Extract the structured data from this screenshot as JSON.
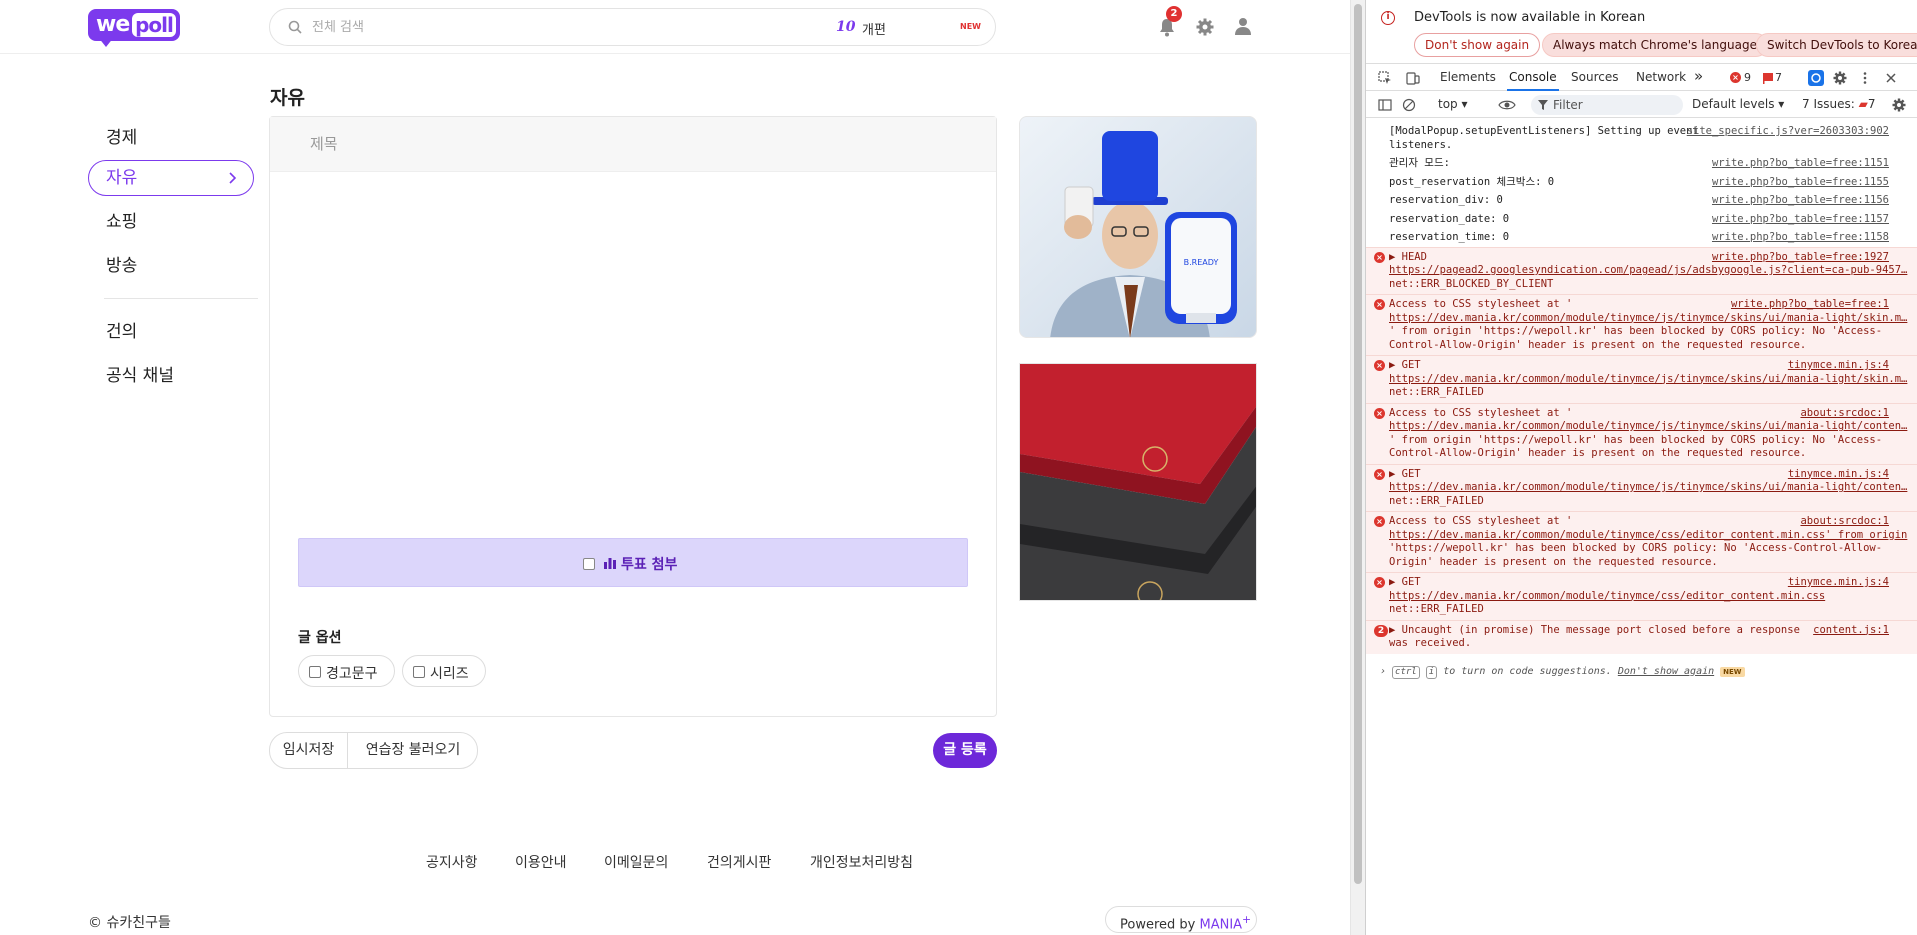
{
  "site": {
    "logo_we": "we",
    "logo_poll": "poll",
    "search_placeholder": "전체 검색",
    "trend_rank": "10",
    "trend_word": "개편",
    "trend_new": "NEW",
    "notification_count": "2",
    "sidebar": [
      {
        "label": "경제",
        "active": false
      },
      {
        "label": "자유",
        "active": true
      },
      {
        "label": "쇼핑",
        "active": false
      },
      {
        "label": "방송",
        "active": false
      },
      {
        "label": "건의",
        "active": false
      },
      {
        "label": "공식 채널",
        "active": false
      }
    ],
    "board_title": "자유",
    "title_placeholder": "제목",
    "poll_attach": "투표 첨부",
    "options_title": "글 옵션",
    "options": [
      "경고문구",
      "시리즈"
    ],
    "temp_save": "임시저장",
    "load_draft": "연습장 불러오기",
    "submit": "글 등록",
    "ad_product_label": "B.READY",
    "footer_links": [
      "공지사항",
      "이용안내",
      "이메일문의",
      "건의게시판",
      "개인정보처리방침"
    ],
    "copyright": "© 슈카친구들",
    "powered_prefix": "Powered by ",
    "powered_brand": "MANIA",
    "powered_sup": "+"
  },
  "devtools": {
    "info_text": "DevTools is now available in Korean",
    "btn_dont_show": "Don't show again",
    "btn_match": "Always match Chrome's language",
    "btn_switch": "Switch DevTools to Korean",
    "tabs": [
      "Elements",
      "Console",
      "Sources",
      "Network"
    ],
    "more_tabs": "»",
    "error_count": "9",
    "warn_count": "7",
    "context": "top ▾",
    "filter_placeholder": "Filter",
    "levels": "Default levels ▾",
    "issues_label": "7 Issues:",
    "issues_count": "7",
    "logs": [
      {
        "type": "log",
        "lines": [
          "[ModalPopup.setupEventListeners] Setting up event",
          "listeners."
        ],
        "src": "site_specific.js?ver=2603303:902"
      },
      {
        "type": "log",
        "lines": [
          "관리자 모드:"
        ],
        "src": "write.php?bo_table=free:1151"
      },
      {
        "type": "log",
        "lines": [
          "post_reservation 체크박스: 0"
        ],
        "src": "write.php?bo_table=free:1155"
      },
      {
        "type": "log",
        "lines": [
          "reservation_div: 0"
        ],
        "src": "write.php?bo_table=free:1156"
      },
      {
        "type": "log",
        "lines": [
          "reservation_date: 0"
        ],
        "src": "write.php?bo_table=free:1157"
      },
      {
        "type": "log",
        "lines": [
          "reservation_time: 0"
        ],
        "src": "write.php?bo_table=free:1158"
      },
      {
        "type": "err",
        "lines": [
          "▶ HEAD",
          "https://pagead2.googlesyndication.com/pagead/js/adsbygoogle.js?client=ca-pub-9457…",
          "net::ERR_BLOCKED_BY_CLIENT"
        ],
        "src": "write.php?bo_table=free:1927"
      },
      {
        "type": "err",
        "lines": [
          "Access to CSS stylesheet at '",
          "https://dev.mania.kr/common/module/tinymce/js/tinymce/skins/ui/mania-light/skin.m…",
          "' from origin 'https://wepoll.kr' has been blocked by CORS policy: No 'Access-",
          "Control-Allow-Origin' header is present on the requested resource."
        ],
        "src": "write.php?bo_table=free:1"
      },
      {
        "type": "err",
        "lines": [
          "▶ GET",
          "https://dev.mania.kr/common/module/tinymce/js/tinymce/skins/ui/mania-light/skin.m…",
          "net::ERR_FAILED"
        ],
        "src": "tinymce.min.js:4"
      },
      {
        "type": "err",
        "lines": [
          "Access to CSS stylesheet at '",
          "https://dev.mania.kr/common/module/tinymce/js/tinymce/skins/ui/mania-light/conten…",
          "' from origin 'https://wepoll.kr' has been blocked by CORS policy: No 'Access-",
          "Control-Allow-Origin' header is present on the requested resource."
        ],
        "src": "about:srcdoc:1"
      },
      {
        "type": "err",
        "lines": [
          "▶ GET",
          "https://dev.mania.kr/common/module/tinymce/js/tinymce/skins/ui/mania-light/conten…",
          "net::ERR_FAILED"
        ],
        "src": "tinymce.min.js:4"
      },
      {
        "type": "err",
        "lines": [
          "Access to CSS stylesheet at '",
          "https://dev.mania.kr/common/module/tinymce/css/editor_content.min.css' from origin",
          "'https://wepoll.kr' has been blocked by CORS policy: No 'Access-Control-Allow-",
          "Origin' header is present on the requested resource."
        ],
        "src": "about:srcdoc:1"
      },
      {
        "type": "err",
        "lines": [
          "▶ GET",
          "https://dev.mania.kr/common/module/tinymce/css/editor_content.min.css",
          "net::ERR_FAILED"
        ],
        "src": "tinymce.min.js:4"
      },
      {
        "type": "err2",
        "count": "2",
        "lines": [
          "▶ Uncaught (in promise) The message port closed before a response",
          "was received."
        ],
        "src": "content.js:1"
      }
    ],
    "hint_ctrl": "ctrl",
    "hint_i": "i",
    "hint_text": " to turn on code suggestions. ",
    "hint_link": "Don't show again",
    "hint_new": "NEW"
  }
}
